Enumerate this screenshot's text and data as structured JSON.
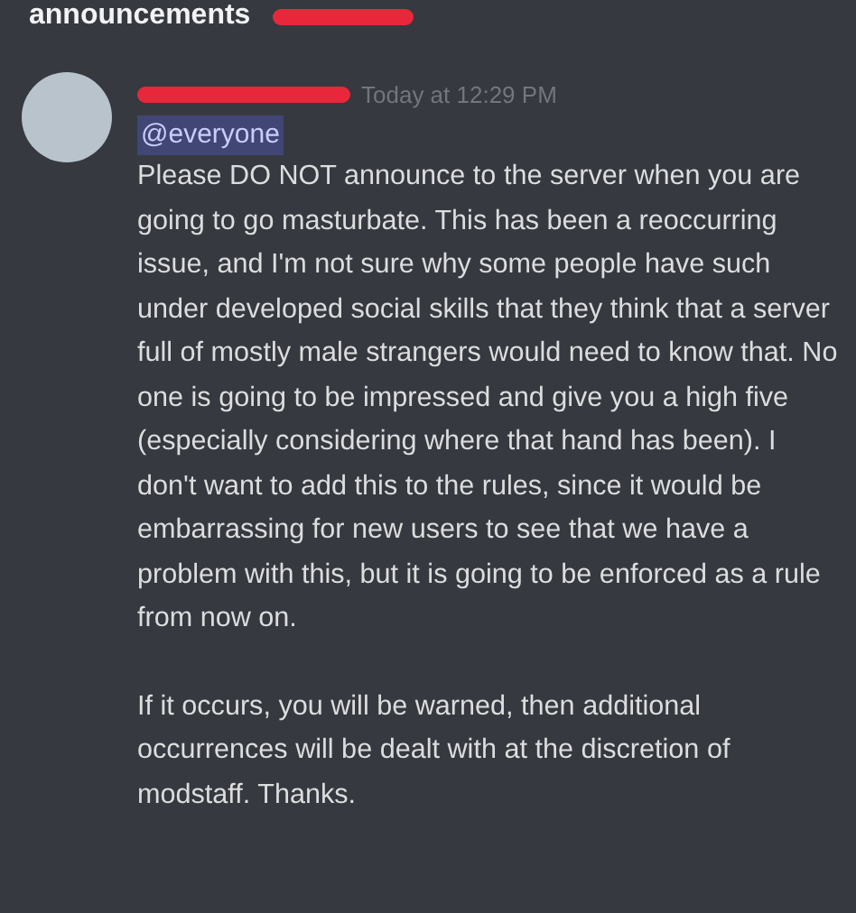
{
  "channel": {
    "name": "announcements"
  },
  "message": {
    "timestamp": "Today at 12:29 PM",
    "mention": "@everyone",
    "paragraphs": [
      "Please DO NOT announce to the server when you are going to go masturbate. This has been a reoccurring issue, and I'm not sure why some people have such under developed social skills that they think that a server full of mostly male strangers would need to know that. No one is going to be impressed and give you a high five (especially considering where that hand has been). I don't want to add this to the rules, since it would be embarrassing for new users to see that we have a problem with this, but it is going to be enforced as a rule from now on.",
      "If it occurs, you will be warned, then additional occurrences will be dealt with at the discretion of modstaff. Thanks."
    ]
  }
}
